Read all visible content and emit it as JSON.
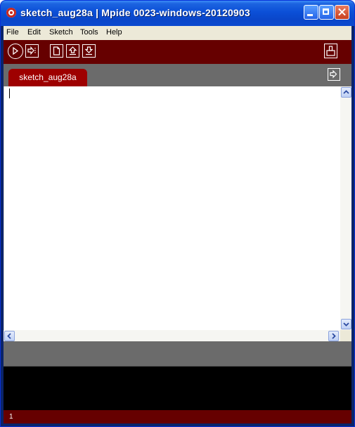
{
  "window": {
    "title": "sketch_aug28a | Mpide 0023-windows-20120903"
  },
  "menubar": {
    "items": [
      "File",
      "Edit",
      "Sketch",
      "Tools",
      "Help"
    ]
  },
  "toolbar": {
    "buttons": [
      {
        "icon": "play-icon"
      },
      {
        "icon": "stop-icon"
      },
      {
        "icon": "new-file-icon"
      },
      {
        "icon": "open-file-icon"
      },
      {
        "icon": "save-file-icon"
      },
      {
        "icon": "serial-monitor-icon"
      }
    ]
  },
  "tabs": {
    "active": "sketch_aug28a",
    "menu_icon": "tab-menu-icon"
  },
  "editor": {
    "content": ""
  },
  "footer": {
    "line_number": "1"
  },
  "colors": {
    "toolbar_bg": "#660000",
    "tab_bg": "#9e0000",
    "tabbar_bg": "#6b6b6b",
    "console_bg": "#000000"
  }
}
